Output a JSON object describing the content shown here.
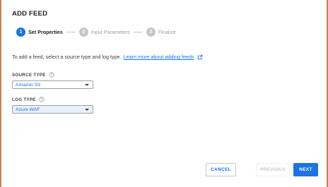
{
  "dialog": {
    "title": "ADD FEED"
  },
  "stepper": {
    "steps": [
      {
        "number": "1",
        "label": "Set Properties",
        "state": "active"
      },
      {
        "number": "2",
        "label": "Input Parameters",
        "state": "inactive"
      },
      {
        "number": "3",
        "label": "Finalize",
        "state": "inactive"
      }
    ]
  },
  "intro": {
    "text": "To add a feed, select a source type and log type.",
    "link_text": "Learn more about adding feeds",
    "link_icon": "external-link-icon"
  },
  "source_type": {
    "label": "SOURCE TYPE",
    "help_icon": "help-circle-icon",
    "value": "Amazon S3"
  },
  "log_type": {
    "label": "LOG TYPE",
    "help_icon": "help-circle-icon",
    "value": "Azure WAF"
  },
  "footer": {
    "cancel_label": "CANCEL",
    "previous_label": "PREVIOUS",
    "next_label": "NEXT"
  },
  "colors": {
    "accent": "#1a73e8",
    "frame_border": "#c8844f",
    "inactive_step": "#c4c7cc"
  }
}
